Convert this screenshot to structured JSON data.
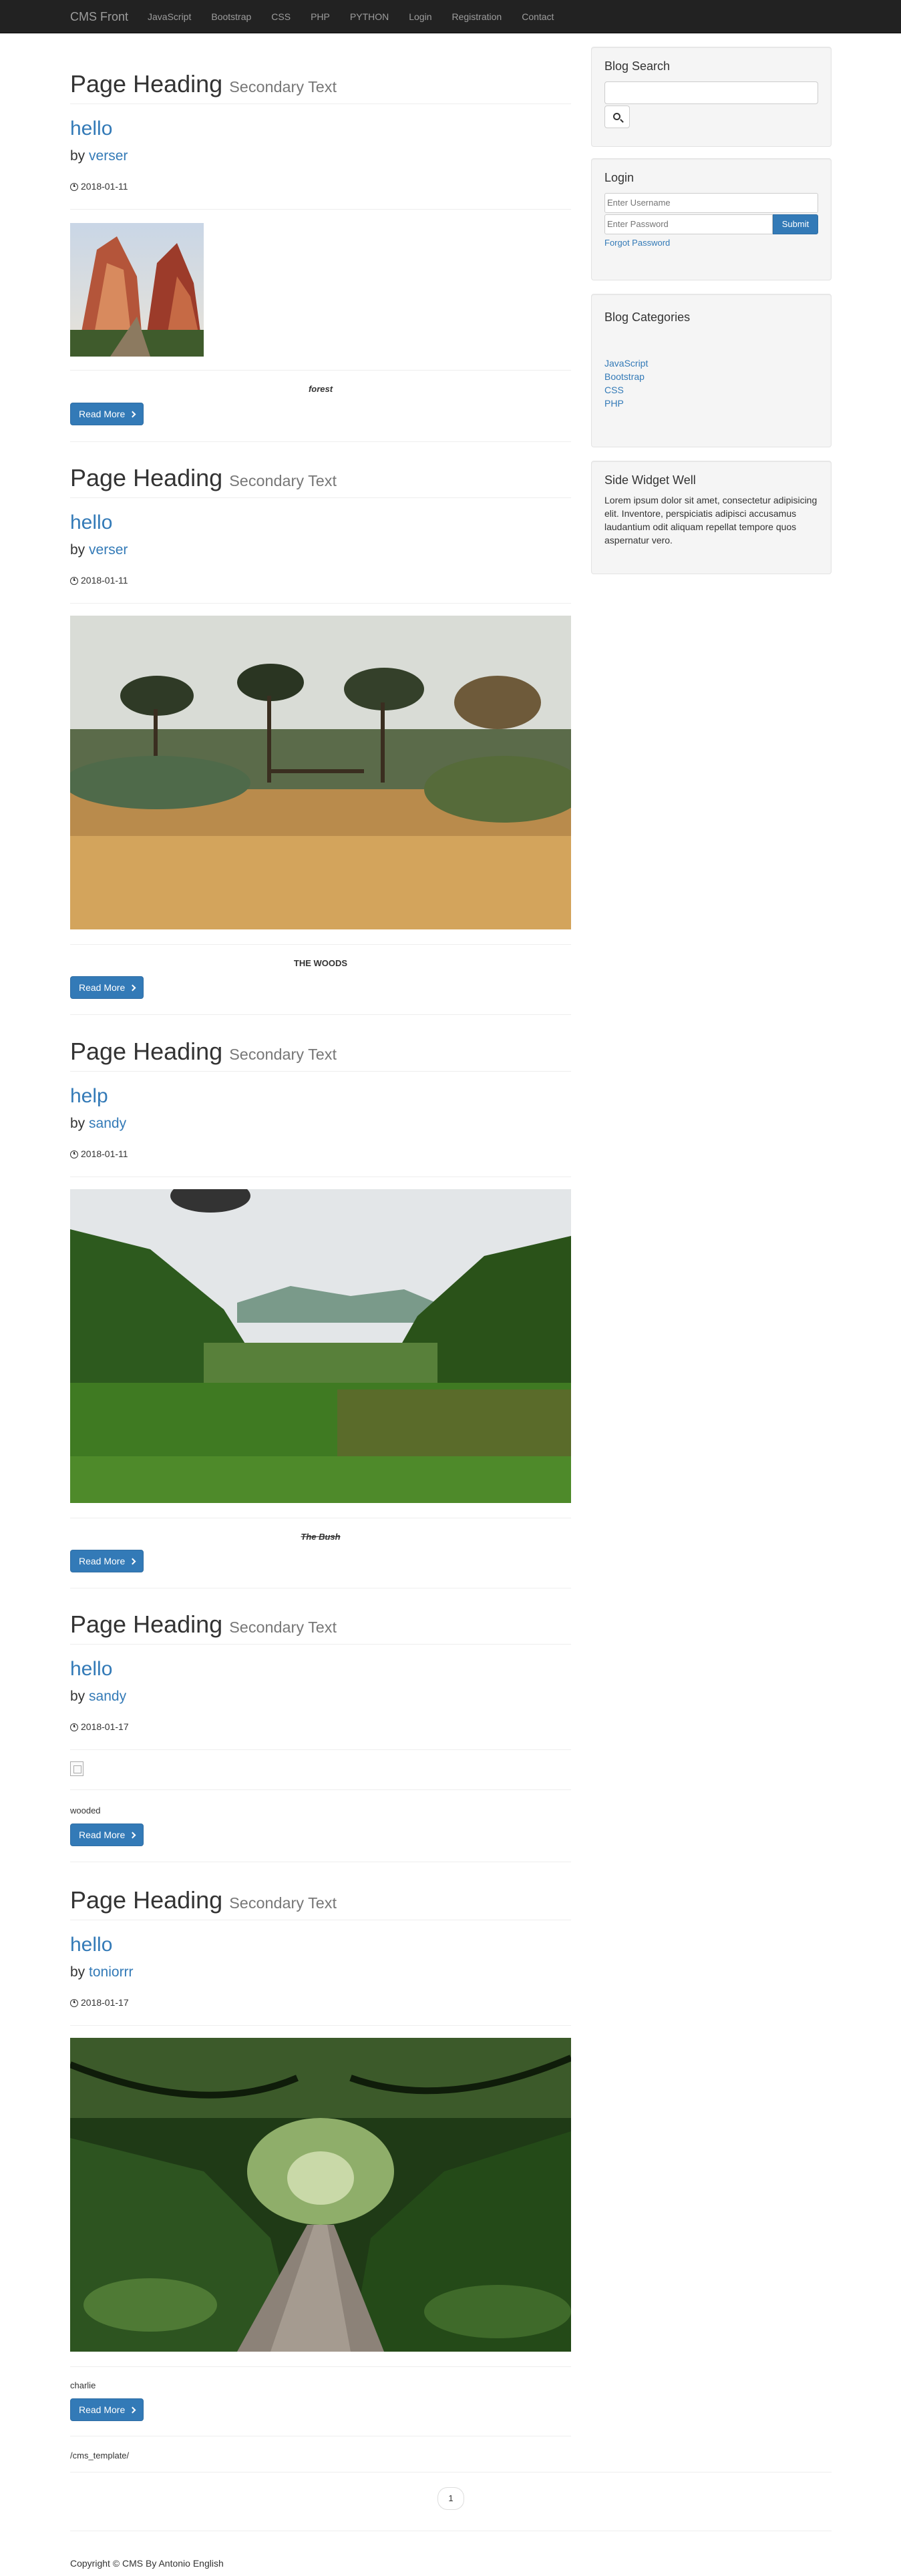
{
  "nav": {
    "brand": "CMS Front",
    "items": [
      "JavaScript",
      "Bootstrap",
      "CSS",
      "PHP",
      "PYTHON",
      "Login",
      "Registration",
      "Contact"
    ]
  },
  "posts": [
    {
      "heading": "Page Heading",
      "secondary": "Secondary Text",
      "title": "hello",
      "by": "by",
      "author": "verser",
      "date": "2018-01-11",
      "caption": "forest",
      "read_more": "Read More",
      "image_icon": "mountain-landscape"
    },
    {
      "heading": "Page Heading",
      "secondary": "Secondary Text",
      "title": "hello",
      "by": "by",
      "author": "verser",
      "date": "2018-01-11",
      "caption": "THE WOODS",
      "read_more": "Read More",
      "image_icon": "garden-landscape"
    },
    {
      "heading": "Page Heading",
      "secondary": "Secondary Text",
      "title": "help",
      "by": "by",
      "author": "sandy",
      "date": "2018-01-11",
      "caption": "The Bush",
      "read_more": "Read More",
      "image_icon": "valley-landscape"
    },
    {
      "heading": "Page Heading",
      "secondary": "Secondary Text",
      "title": "hello",
      "by": "by",
      "author": "sandy",
      "date": "2018-01-17",
      "caption": "wooded",
      "read_more": "Read More",
      "image_icon": "broken-image-icon"
    },
    {
      "heading": "Page Heading",
      "secondary": "Secondary Text",
      "title": "hello",
      "by": "by",
      "author": "toniorrr",
      "date": "2018-01-17",
      "caption": "charlie",
      "read_more": "Read More",
      "image_icon": "forest-path"
    }
  ],
  "sidebar": {
    "search": {
      "title": "Blog Search",
      "value": ""
    },
    "login": {
      "title": "Login",
      "username_placeholder": "Enter Username",
      "password_placeholder": "Enter Password",
      "submit": "Submit",
      "forgot": "Forgot Password"
    },
    "categories": {
      "title": "Blog Categories",
      "items": [
        "JavaScript",
        "Bootstrap",
        "CSS",
        "PHP"
      ]
    },
    "widget": {
      "title": "Side Widget Well",
      "text": "Lorem ipsum dolor sit amet, consectetur adipisicing elit. Inventore, perspiciatis adipisci accusamus laudantium odit aliquam repellat tempore quos aspernatur vero."
    }
  },
  "path_text": "/cms_template/",
  "pagination": {
    "page": "1"
  },
  "footer": "Copyright © CMS By Antonio English"
}
